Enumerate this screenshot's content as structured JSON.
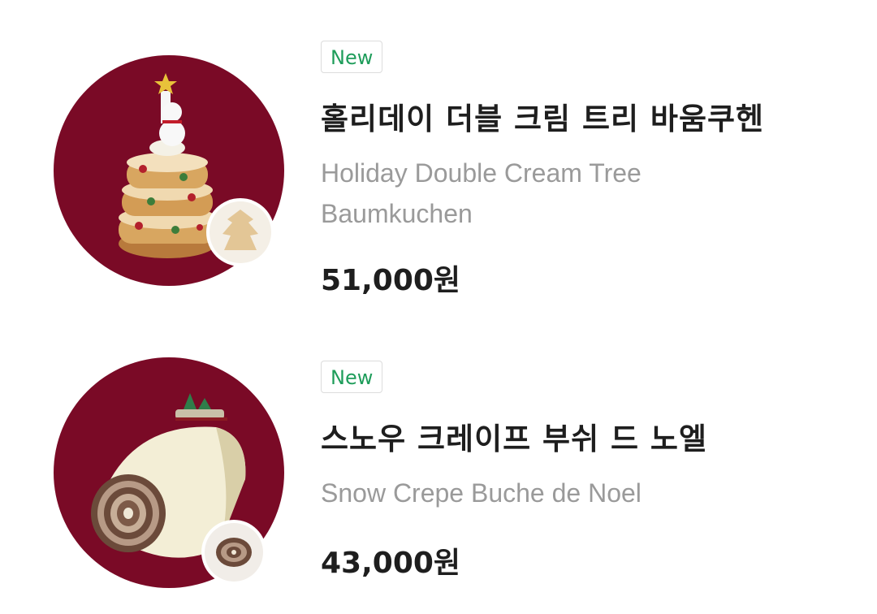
{
  "colors": {
    "circle_bg": "#7a0a26",
    "badge_text": "#1f9d5b",
    "title_text": "#1e1e1e",
    "subtitle_text": "#9a9a9a"
  },
  "products": [
    {
      "badge": "New",
      "name_ko": "홀리데이 더블 크림 트리 바움쿠헨",
      "name_en": "Holiday Double Cream Tree Baumkuchen",
      "price": "51,000원",
      "image_icon": "tree-baumkuchen-cake-icon"
    },
    {
      "badge": "New",
      "name_ko": "스노우 크레이프 부쉬 드 노엘",
      "name_en": "Snow Crepe Buche de Noel",
      "price": "43,000원",
      "image_icon": "crepe-log-cake-icon"
    }
  ]
}
